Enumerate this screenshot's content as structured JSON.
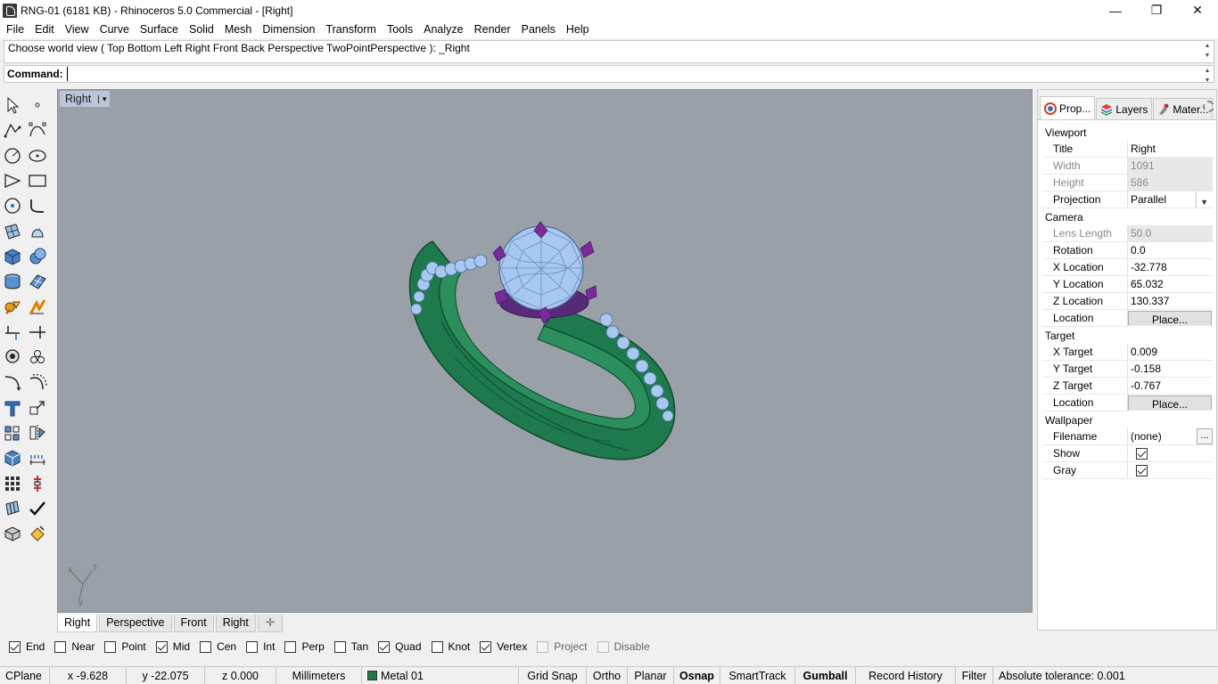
{
  "window": {
    "title": "RNG-01 (6181 KB) - Rhinoceros 5.0 Commercial - [Right]",
    "minimize_glyph": "—",
    "restore_glyph": "❐",
    "close_glyph": "✕"
  },
  "menu": [
    "File",
    "Edit",
    "View",
    "Curve",
    "Surface",
    "Solid",
    "Mesh",
    "Dimension",
    "Transform",
    "Tools",
    "Analyze",
    "Render",
    "Panels",
    "Help"
  ],
  "command": {
    "history": "Choose world view ( Top  Bottom  Left  Right  Front  Back  Perspective  TwoPointPerspective ): _Right",
    "label": "Command:",
    "value": ""
  },
  "toolbar": {
    "tools": [
      [
        "select-arrow-icon",
        "point-icon"
      ],
      [
        "polyline-icon",
        "curve-control-points-icon"
      ],
      [
        "circle-icon",
        "ellipse-icon"
      ],
      [
        "arc-icon",
        "rectangle-icon"
      ],
      [
        "polygon-icon",
        "fillet-curve-icon"
      ],
      [
        "surface-from-points-icon",
        "extrude-surface-icon"
      ],
      [
        "box-icon",
        "sphere-icon"
      ],
      [
        "cylinder-icon",
        "mesh-plane-icon"
      ],
      [
        "boolean-union-icon",
        "explode-icon"
      ],
      [
        "trim-icon",
        "split-icon"
      ],
      [
        "group-icon",
        "array-icon"
      ],
      [
        "curve-fillet-icon",
        "offset-icon"
      ],
      [
        "text-icon",
        "scale-icon"
      ],
      [
        "align-icon",
        "mirror-icon"
      ],
      [
        "render-cube-icon",
        "dimension-icon"
      ],
      [
        "grid-array-icon",
        "move-icon"
      ],
      [
        "lock-icon",
        "checkmark-icon"
      ],
      [
        "layer-state-icon",
        "paint-bucket-icon"
      ]
    ]
  },
  "viewport": {
    "title": "Right",
    "axis": {
      "x": "x",
      "y": "y",
      "z": "z"
    },
    "colors": {
      "background": "#9aa0a8",
      "metal": "#1e7a4c",
      "gems": "#a8c8f0",
      "prongs": "#7a2a9a"
    }
  },
  "viewport_tabs": [
    "Right",
    "Perspective",
    "Front",
    "Right"
  ],
  "add_tab_glyph": "✛",
  "osnaps": [
    {
      "label": "End",
      "checked": true,
      "enabled": true
    },
    {
      "label": "Near",
      "checked": false,
      "enabled": true
    },
    {
      "label": "Point",
      "checked": false,
      "enabled": true
    },
    {
      "label": "Mid",
      "checked": true,
      "enabled": true
    },
    {
      "label": "Cen",
      "checked": false,
      "enabled": true
    },
    {
      "label": "Int",
      "checked": false,
      "enabled": true
    },
    {
      "label": "Perp",
      "checked": false,
      "enabled": true
    },
    {
      "label": "Tan",
      "checked": false,
      "enabled": true
    },
    {
      "label": "Quad",
      "checked": true,
      "enabled": true
    },
    {
      "label": "Knot",
      "checked": false,
      "enabled": true
    },
    {
      "label": "Vertex",
      "checked": true,
      "enabled": true
    },
    {
      "label": "Project",
      "checked": false,
      "enabled": false
    },
    {
      "label": "Disable",
      "checked": false,
      "enabled": false
    }
  ],
  "status": {
    "cplane": "CPlane",
    "x": "x -9.628",
    "y": "y -22.075",
    "z": "z 0.000",
    "units": "Millimeters",
    "layer": "Metal 01",
    "grid_snap": "Grid Snap",
    "ortho": "Ortho",
    "planar": "Planar",
    "osnap": "Osnap",
    "smarttrack": "SmartTrack",
    "gumball": "Gumball",
    "record_history": "Record History",
    "filter": "Filter",
    "tolerance": "Absolute tolerance: 0.001"
  },
  "panel": {
    "tabs": [
      "Prop...",
      "Layers",
      "Mater..."
    ],
    "sections": {
      "viewport": "Viewport",
      "camera": "Camera",
      "target": "Target",
      "wallpaper": "Wallpaper"
    },
    "viewport": {
      "title_k": "Title",
      "title_v": "Right",
      "width_k": "Width",
      "width_v": "1091",
      "height_k": "Height",
      "height_v": "586",
      "projection_k": "Projection",
      "projection_v": "Parallel"
    },
    "camera": {
      "lens_k": "Lens Length",
      "lens_v": "50.0",
      "rotation_k": "Rotation",
      "rotation_v": "0.0",
      "xloc_k": "X Location",
      "xloc_v": "-32.778",
      "yloc_k": "Y Location",
      "yloc_v": "65.032",
      "zloc_k": "Z Location",
      "zloc_v": "130.337",
      "loc_k": "Location",
      "loc_btn": "Place..."
    },
    "target": {
      "x_k": "X Target",
      "x_v": "0.009",
      "y_k": "Y Target",
      "y_v": "-0.158",
      "z_k": "Z Target",
      "z_v": "-0.767",
      "loc_k": "Location",
      "loc_btn": "Place..."
    },
    "wallpaper": {
      "filename_k": "Filename",
      "filename_v": "(none)",
      "browse_btn": "...",
      "show_k": "Show",
      "show_checked": true,
      "gray_k": "Gray",
      "gray_checked": true
    }
  }
}
